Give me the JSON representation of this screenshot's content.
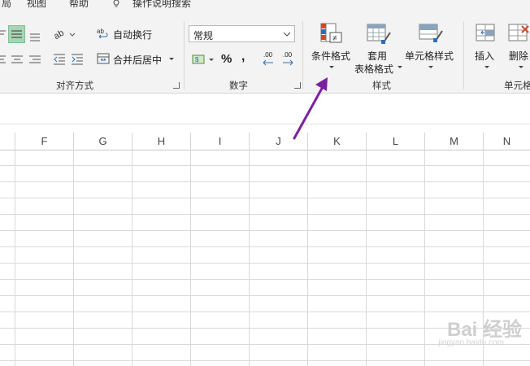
{
  "tabs": [
    "局",
    "视图",
    "帮助",
    "操作说明搜索"
  ],
  "alignment": {
    "wrap_text": "自动换行",
    "merge_center": "合并后居中",
    "group_label": "对齐方式"
  },
  "number": {
    "format_value": "常规",
    "percent": "%",
    "comma": ",",
    "inc_decimal": ".00",
    "dec_decimal": ".00",
    "group_label": "数字"
  },
  "styles": {
    "conditional": "条件格式",
    "table_line1": "套用",
    "table_line2": "表格格式",
    "cell_styles": "单元格样式",
    "group_label": "样式"
  },
  "cells": {
    "insert": "插入",
    "delete": "删除",
    "group_label": "单元格"
  },
  "columns": [
    "F",
    "G",
    "H",
    "I",
    "J",
    "K",
    "L",
    "M",
    "N"
  ],
  "annotation": {
    "arrow_color": "#7b1fa2"
  },
  "watermark": {
    "line1": "Bai 经验",
    "line2": "jingyan.baidu.com"
  }
}
